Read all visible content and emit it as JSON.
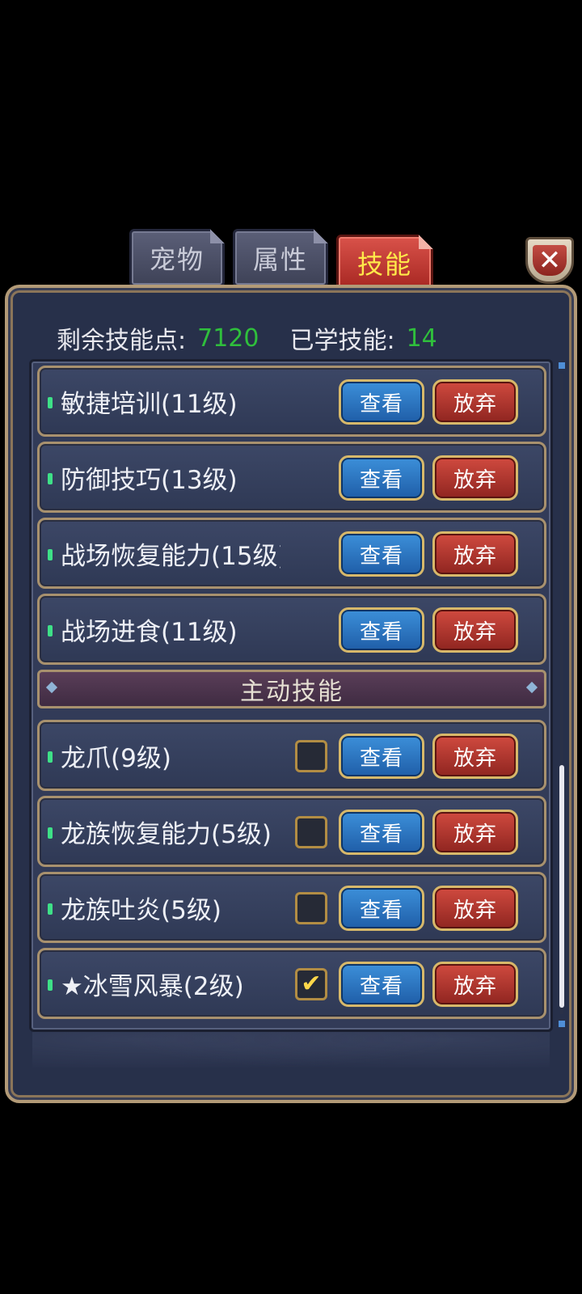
{
  "tabs": [
    {
      "label": "宠物",
      "active": false
    },
    {
      "label": "属性",
      "active": false
    },
    {
      "label": "技能",
      "active": true
    }
  ],
  "close_label": "✕",
  "stats": {
    "remaining_label": "剩余技能点:",
    "remaining_value": "7120",
    "learned_label": "已学技能:",
    "learned_value": "14"
  },
  "passive_skills": [
    {
      "name": "敏捷培训(11级)"
    },
    {
      "name": "防御技巧(13级)"
    },
    {
      "name": "战场恢复能力(15级)"
    },
    {
      "name": "战场进食(11级)"
    }
  ],
  "section_title": "主动技能",
  "active_skills": [
    {
      "name": "龙爪(9级)",
      "checked": false
    },
    {
      "name": "龙族恢复能力(5级)",
      "checked": false
    },
    {
      "name": "龙族吐炎(5级)",
      "checked": false
    },
    {
      "name": "★冰雪风暴(2级)",
      "checked": true
    }
  ],
  "buttons": {
    "view": "查看",
    "drop": "放弃"
  },
  "colors": {
    "accent_green": "#2fbf3c",
    "active_tab_text": "#ffe94a",
    "panel_bg": "#27304a"
  }
}
